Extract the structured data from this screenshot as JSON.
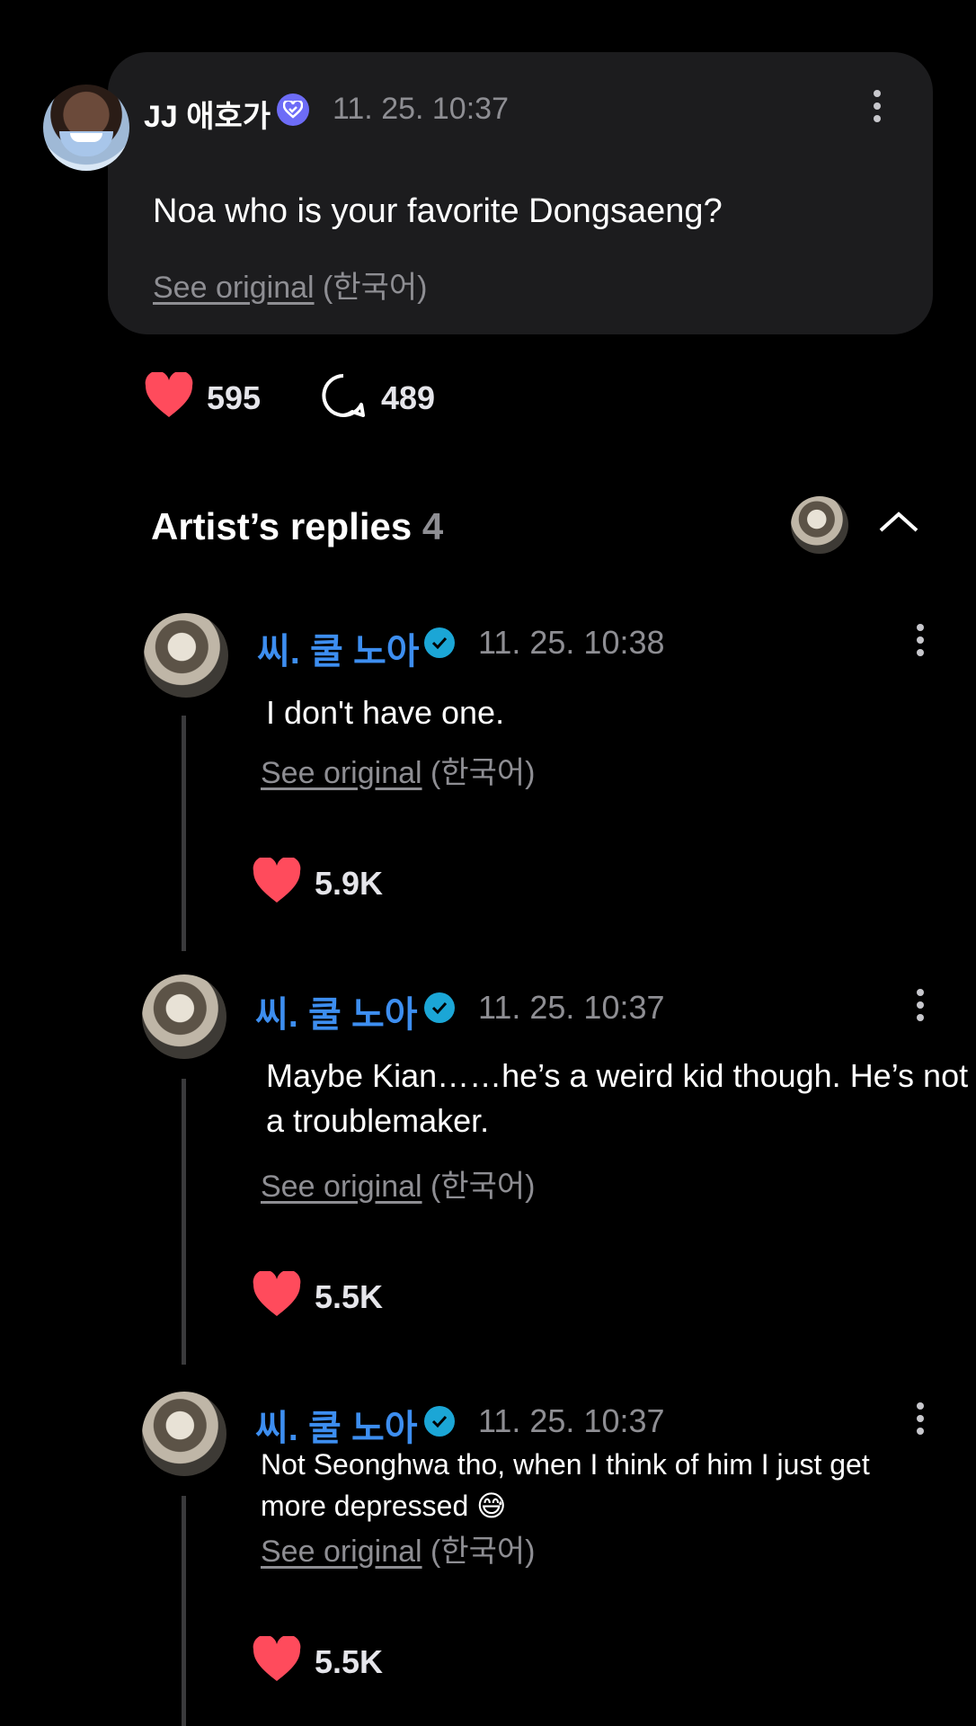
{
  "post": {
    "author": "JJ 애호가",
    "time": "11. 25. 10:37",
    "text": "Noa who is your favorite Dongsaeng?",
    "see_original": "See original",
    "language": "(한국어)",
    "likes": "595",
    "comments": "489"
  },
  "replies_section": {
    "title": "Artist’s replies",
    "count": "4"
  },
  "replies": [
    {
      "author": "씨. 쿨 노아",
      "time": "11. 25. 10:38",
      "text": "I don't have one.",
      "see_original": "See original",
      "language": "(한국어)",
      "likes": "5.9K"
    },
    {
      "author": "씨. 쿨 노아",
      "time": "11. 25. 10:37",
      "text_line1": "Maybe Kian……he’s a weird kid though. He’s not",
      "text_line2": "a troublemaker.",
      "see_original": "See original",
      "language": "(한국어)",
      "likes": "5.5K"
    },
    {
      "author": "씨. 쿨 노아",
      "time": "11. 25. 10:37",
      "text_line1": "Not Seonghwa tho, when I think of him I just get",
      "text_line2": "more depressed 😅",
      "see_original": "See original",
      "language": "(한국어)",
      "likes": "5.5K"
    }
  ],
  "colors": {
    "background": "#000000",
    "card": "#1c1c1e",
    "heart": "#ff4b5c",
    "artist_name": "#3d8ef0",
    "verified_badge": "#1ba6d6",
    "fan_badge": "#6d6cf7",
    "muted": "#8e8e93"
  }
}
